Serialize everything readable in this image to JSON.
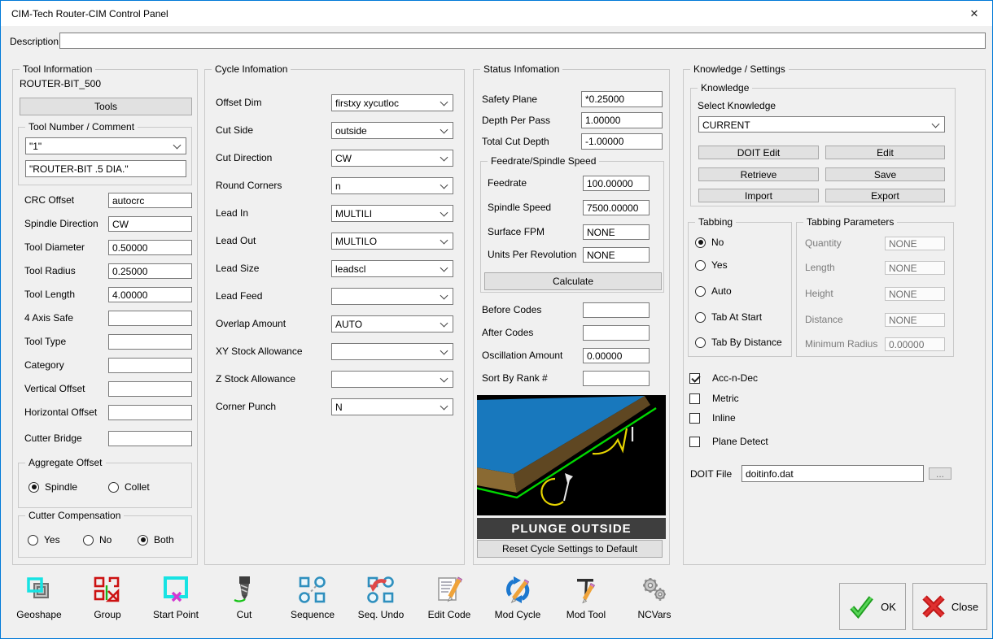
{
  "window": {
    "title": "CIM-Tech Router-CIM Control Panel",
    "close_glyph": "✕"
  },
  "description": {
    "label": "Description",
    "value": ""
  },
  "tool_info": {
    "title": "Tool Information",
    "tool_name": "ROUTER-BIT_500",
    "tools_button": "Tools",
    "number_group": {
      "title": "Tool Number / Comment",
      "number": "\"1\"",
      "comment": "\"ROUTER-BIT .5 DIA.\""
    },
    "fields": [
      {
        "label": "CRC Offset",
        "value": "autocrc"
      },
      {
        "label": "Spindle Direction",
        "value": "CW"
      },
      {
        "label": "Tool Diameter",
        "value": "0.50000"
      },
      {
        "label": "Tool Radius",
        "value": "0.25000"
      },
      {
        "label": "Tool Length",
        "value": "4.00000"
      },
      {
        "label": "4 Axis Safe",
        "value": ""
      },
      {
        "label": "Tool Type",
        "value": ""
      },
      {
        "label": "Category",
        "value": ""
      },
      {
        "label": "Vertical Offset",
        "value": ""
      },
      {
        "label": "Horizontal Offset",
        "value": ""
      },
      {
        "label": "Cutter Bridge",
        "value": ""
      }
    ],
    "aggregate_offset": {
      "title": "Aggregate Offset",
      "options": [
        {
          "label": "Spindle",
          "selected": true
        },
        {
          "label": "Collet",
          "selected": false
        }
      ]
    },
    "cutter_comp": {
      "title": "Cutter Compensation",
      "options": [
        {
          "label": "Yes",
          "selected": false
        },
        {
          "label": "No",
          "selected": false
        },
        {
          "label": "Both",
          "selected": true
        }
      ]
    }
  },
  "cycle_info": {
    "title": "Cycle Infomation",
    "fields": [
      {
        "label": "Offset Dim",
        "value": "firstxy xycutloc"
      },
      {
        "label": "Cut Side",
        "value": "outside"
      },
      {
        "label": "Cut Direction",
        "value": "CW"
      },
      {
        "label": "Round Corners",
        "value": "n"
      },
      {
        "label": "Lead In",
        "value": "MULTILI"
      },
      {
        "label": "Lead Out",
        "value": "MULTILO"
      },
      {
        "label": "Lead Size",
        "value": "leadscl"
      },
      {
        "label": "Lead Feed",
        "value": ""
      },
      {
        "label": "Overlap Amount",
        "value": "AUTO"
      },
      {
        "label": "XY Stock Allowance",
        "value": ""
      },
      {
        "label": "Z Stock Allowance",
        "value": ""
      },
      {
        "label": "Corner Punch",
        "value": "N"
      }
    ]
  },
  "status_info": {
    "title": "Status Infomation",
    "fields": [
      {
        "label": "Safety Plane",
        "value": "*0.25000"
      },
      {
        "label": "Depth Per Pass",
        "value": "1.00000"
      },
      {
        "label": "Total Cut Depth",
        "value": "-1.00000"
      }
    ],
    "feedrate_group": {
      "title": "Feedrate/Spindle Speed",
      "fields": [
        {
          "label": "Feedrate",
          "value": "100.00000"
        },
        {
          "label": "Spindle Speed",
          "value": "7500.00000"
        },
        {
          "label": "Surface FPM",
          "value": "NONE"
        },
        {
          "label": "Units Per Revolution",
          "value": "NONE"
        }
      ],
      "calculate_button": "Calculate"
    },
    "extra_fields": [
      {
        "label": "Before Codes",
        "value": ""
      },
      {
        "label": "After Codes",
        "value": ""
      },
      {
        "label": "Oscillation Amount",
        "value": "0.00000"
      },
      {
        "label": "Sort By Rank #",
        "value": ""
      }
    ],
    "preview_caption": "PLUNGE OUTSIDE",
    "reset_button": "Reset Cycle Settings to Default"
  },
  "knowledge": {
    "title": "Knowledge / Settings",
    "group": {
      "title": "Knowledge",
      "select_label": "Select Knowledge",
      "value": "CURRENT",
      "buttons": [
        "DOIT Edit",
        "Edit",
        "Retrieve",
        "Save",
        "Import",
        "Export"
      ]
    },
    "tabbing": {
      "title": "Tabbing",
      "options": [
        {
          "label": "No",
          "selected": true
        },
        {
          "label": "Yes",
          "selected": false
        },
        {
          "label": "Auto",
          "selected": false
        },
        {
          "label": "Tab At Start",
          "selected": false
        },
        {
          "label": "Tab By Distance",
          "selected": false
        }
      ]
    },
    "tabbing_params": {
      "title": "Tabbing Parameters",
      "fields": [
        {
          "label": "Quantity",
          "value": "NONE"
        },
        {
          "label": "Length",
          "value": "NONE"
        },
        {
          "label": "Height",
          "value": "NONE"
        },
        {
          "label": "Distance",
          "value": "NONE"
        },
        {
          "label": "Minimum Radius",
          "value": "0.00000"
        }
      ]
    },
    "checkboxes": [
      {
        "label": "Acc-n-Dec",
        "checked": true
      },
      {
        "label": "Metric",
        "checked": false
      },
      {
        "label": "Inline",
        "checked": false
      },
      {
        "label": "Plane Detect",
        "checked": false
      }
    ],
    "doit_file": {
      "label": "DOIT File",
      "value": "doitinfo.dat",
      "browse_label": "..."
    }
  },
  "toolbar": {
    "items": [
      {
        "label": "Geoshape"
      },
      {
        "label": "Group"
      },
      {
        "label": "Start Point"
      },
      {
        "label": "Cut"
      },
      {
        "label": "Sequence"
      },
      {
        "label": "Seq. Undo"
      },
      {
        "label": "Edit Code"
      },
      {
        "label": "Mod Cycle"
      },
      {
        "label": "Mod Tool"
      },
      {
        "label": "NCVars"
      }
    ],
    "ok_label": "OK",
    "close_label": "Close"
  },
  "colors": {
    "accent_blue": "#0079d8",
    "icon_cyan": "#17e3e3",
    "icon_red": "#cc1111",
    "ok_green": "#1f9e1f",
    "close_red": "#c01818",
    "preview_board_blue": "#1878bd",
    "preview_outline_green": "#00d800",
    "preview_lead_yellow": "#e6d400"
  }
}
